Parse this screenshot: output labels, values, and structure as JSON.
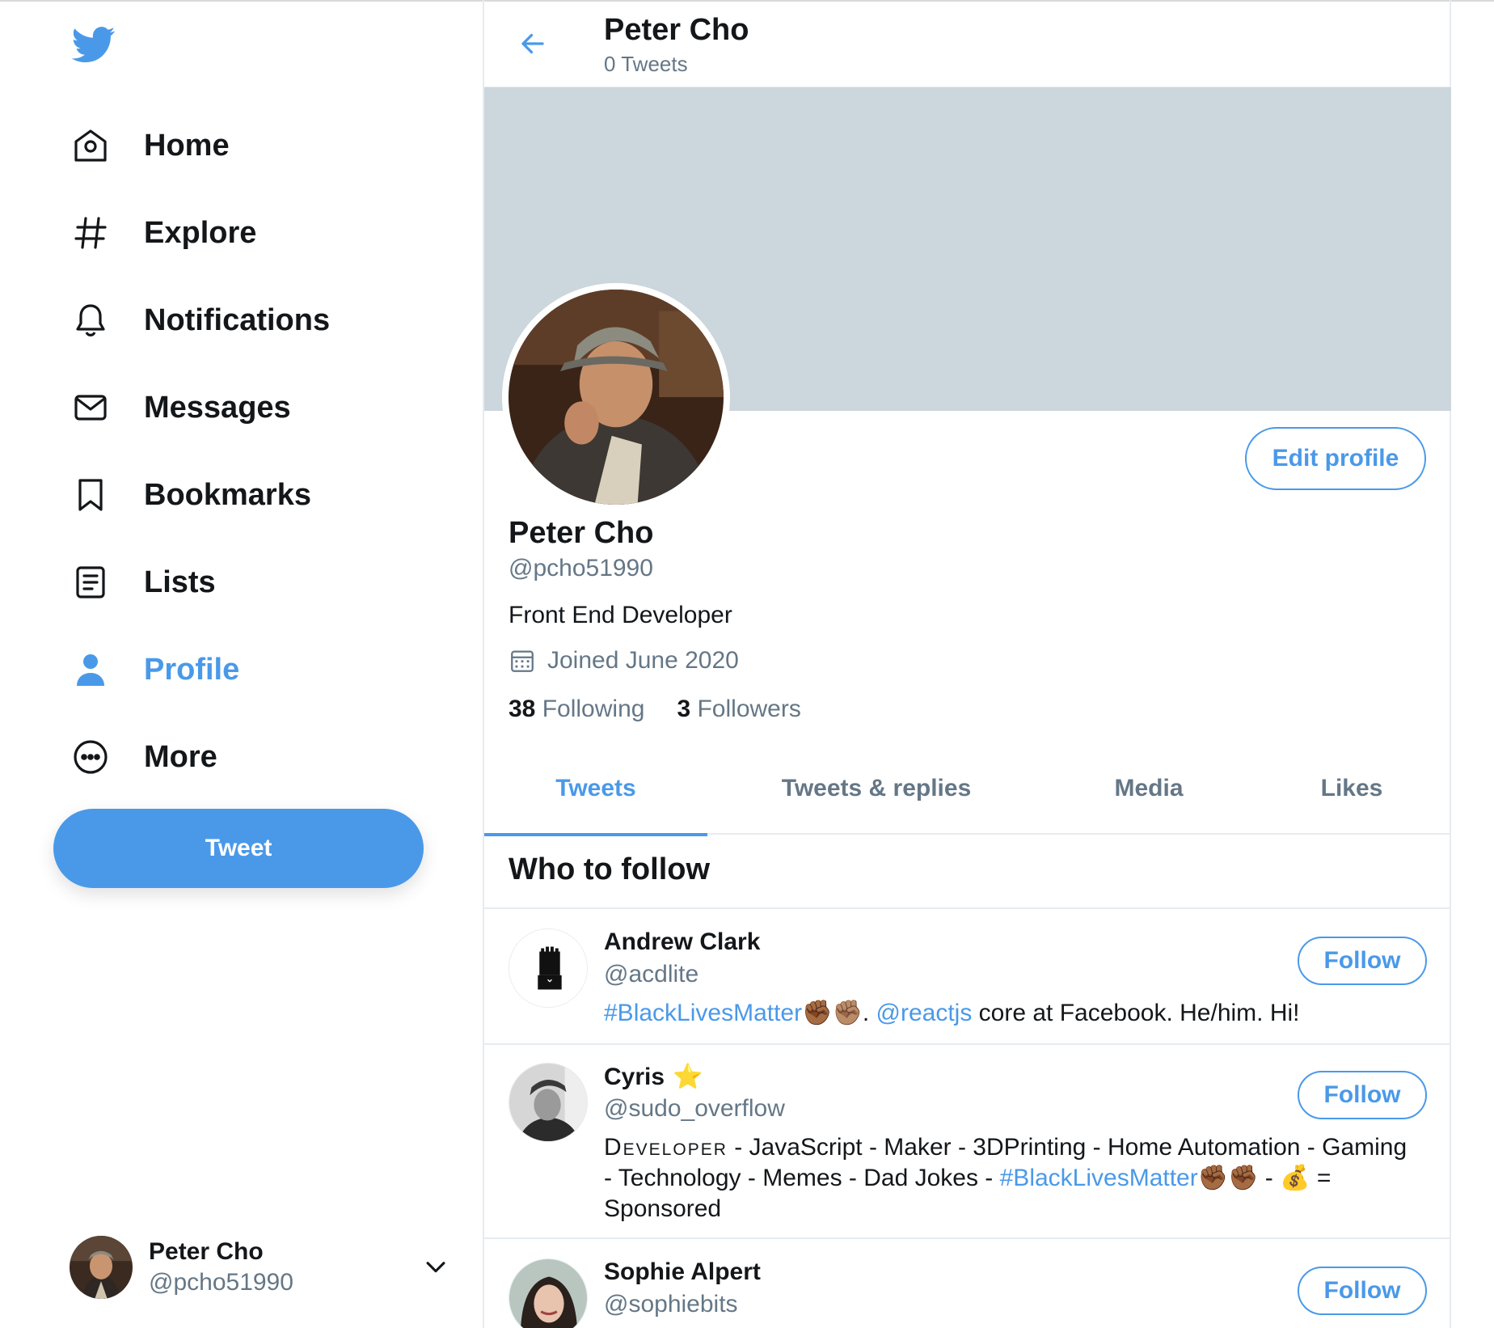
{
  "nav": {
    "items": [
      {
        "label": "Home",
        "icon": "home-icon"
      },
      {
        "label": "Explore",
        "icon": "hashtag-icon"
      },
      {
        "label": "Notifications",
        "icon": "bell-icon"
      },
      {
        "label": "Messages",
        "icon": "envelope-icon"
      },
      {
        "label": "Bookmarks",
        "icon": "bookmark-icon"
      },
      {
        "label": "Lists",
        "icon": "list-icon"
      },
      {
        "label": "Profile",
        "icon": "person-icon",
        "active": true
      },
      {
        "label": "More",
        "icon": "more-icon"
      }
    ],
    "tweet_button": "Tweet"
  },
  "account": {
    "name": "Peter Cho",
    "handle": "@pcho51990"
  },
  "header": {
    "name": "Peter Cho",
    "tweet_count": "0 Tweets"
  },
  "profile": {
    "name": "Peter Cho",
    "handle": "@pcho51990",
    "bio": "Front End Developer",
    "joined": "Joined June 2020",
    "following_count": "38",
    "following_label": "Following",
    "followers_count": "3",
    "followers_label": "Followers",
    "edit_button": "Edit profile"
  },
  "tabs": [
    "Tweets",
    "Tweets & replies",
    "Media",
    "Likes"
  ],
  "who_to_follow": {
    "title": "Who to follow",
    "follow_label": "Follow",
    "users": [
      {
        "name": "Andrew Clark",
        "handle": "@acdlite",
        "bio": {
          "hashtag": "#BlackLivesMatter",
          "emoji": "✊🏾✊🏽",
          "sep": ". ",
          "mention": "@reactjs",
          "rest": " core at Facebook. He/him. Hi!"
        }
      },
      {
        "name": "Cyris",
        "badge": "⭐",
        "handle": "@sudo_overflow",
        "bio": {
          "word1": "Developer",
          "text1": " - JavaScript - Maker - 3DPrinting - Home Automation - Gaming - Technology - Memes - Dad Jokes - ",
          "hashtag": "#BlackLivesMatter",
          "emoji": "✊🏾✊🏾",
          "text2": " - ",
          "money": "💰",
          "text3": " = Sponsored"
        }
      },
      {
        "name": "Sophie Alpert",
        "handle": "@sophiebits"
      }
    ]
  },
  "colors": {
    "accent": "#4a99e9",
    "muted": "#657786",
    "banner": "#ccd6dd",
    "border": "#e6ecf0"
  }
}
